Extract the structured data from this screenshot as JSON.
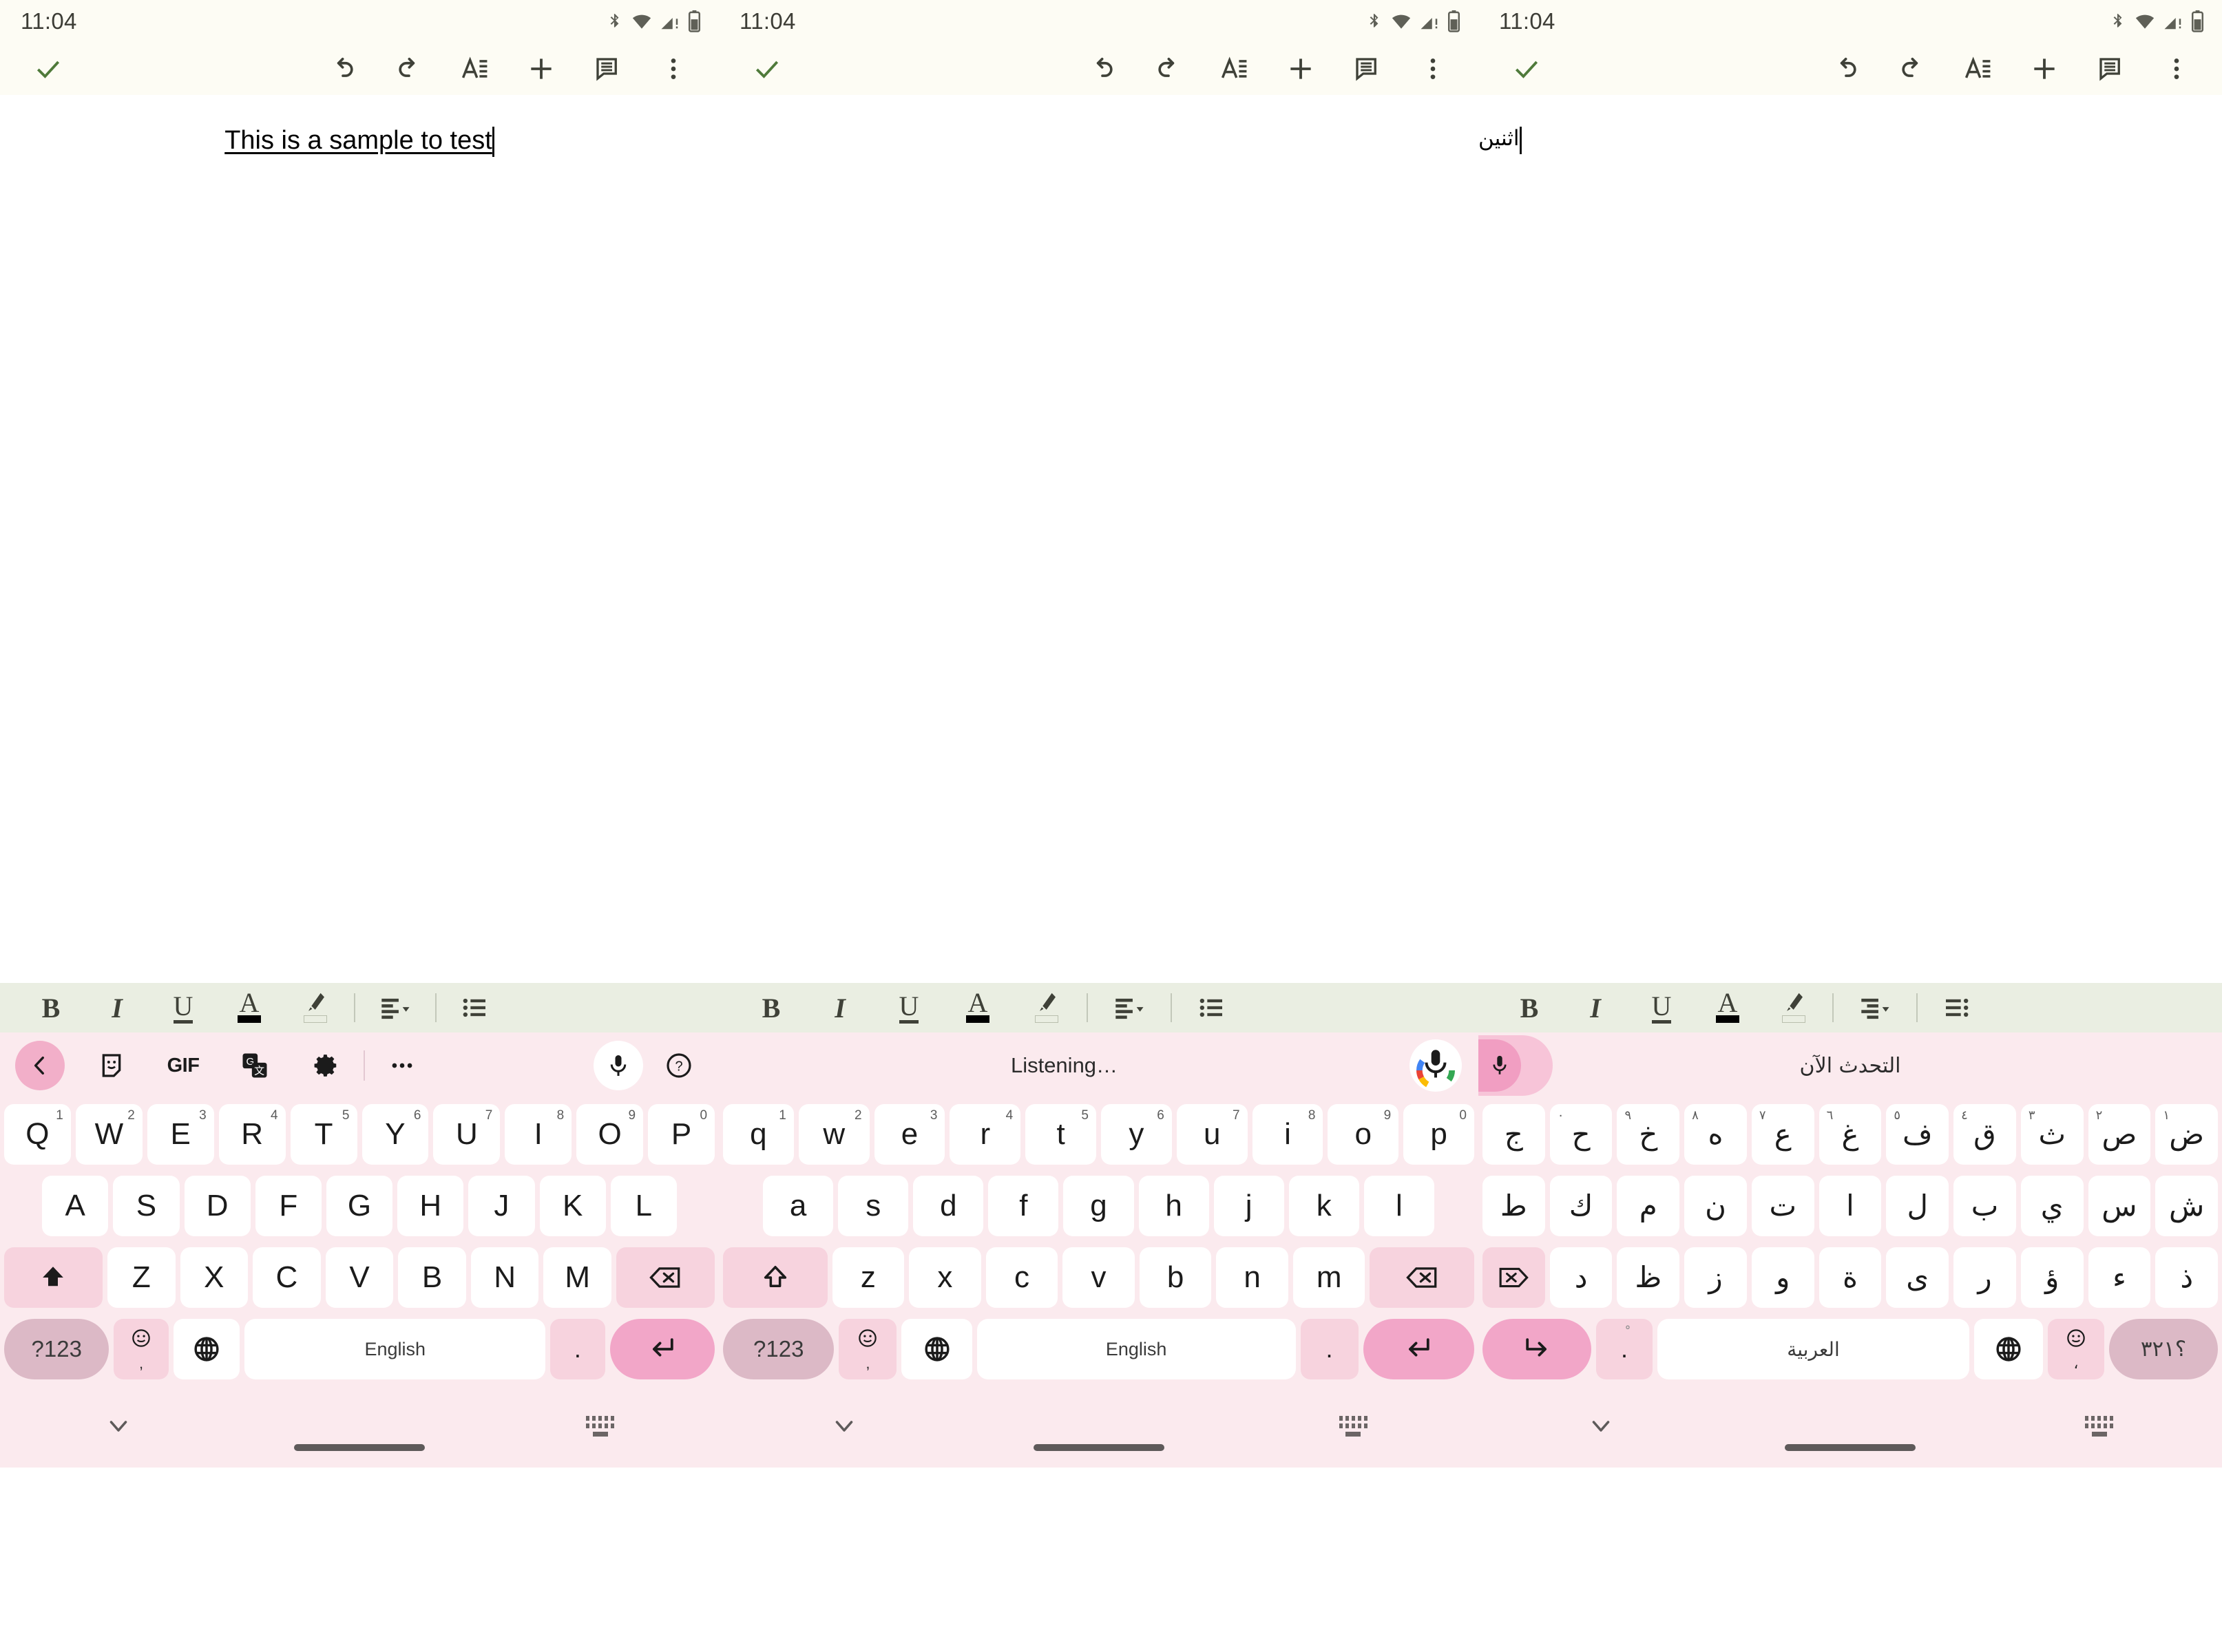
{
  "status": {
    "time": "11:04",
    "icons": [
      "bluetooth-icon",
      "wifi-icon",
      "cellular-alert-icon",
      "battery-icon"
    ]
  },
  "app_toolbar": {
    "accept_label": "check-icon",
    "actions": [
      {
        "name": "undo-button",
        "icon": "undo-icon"
      },
      {
        "name": "redo-button",
        "icon": "redo-icon"
      },
      {
        "name": "format-button",
        "icon": "text-format-icon"
      },
      {
        "name": "insert-button",
        "icon": "plus-icon"
      },
      {
        "name": "comment-button",
        "icon": "comment-icon"
      },
      {
        "name": "overflow-menu-button",
        "icon": "more-vert-icon"
      }
    ]
  },
  "documents": {
    "english_text": "This is a sample to test",
    "arabic_text": "اثنين"
  },
  "format_toolbar": {
    "bold": "B",
    "italic": "I",
    "underline": "U",
    "text_color": "A",
    "text_color_swatch": "#000000",
    "highlight": "highlighter-icon",
    "highlight_swatch": "none",
    "align": "align-left-icon",
    "align_rtl": "align-right-icon",
    "list": "bulleted-list-icon"
  },
  "keyboard_toolbar": {
    "back": "chevron-left-icon",
    "sticker": "sticker-icon",
    "gif": "GIF",
    "translate": "translate-icon",
    "settings": "gear-icon",
    "more": "more-horiz-icon",
    "mic": "mic-icon",
    "help": "help-icon"
  },
  "voice": {
    "english_status": "Listening…",
    "arabic_status": "التحدث الآن",
    "mic_icon": "google-mic-icon",
    "mic_colors": [
      "#4285f4",
      "#ea4335",
      "#fbbc05",
      "#34a853"
    ]
  },
  "keyboard_en_upper": {
    "row1": [
      {
        "k": "Q",
        "n": "1"
      },
      {
        "k": "W",
        "n": "2"
      },
      {
        "k": "E",
        "n": "3"
      },
      {
        "k": "R",
        "n": "4"
      },
      {
        "k": "T",
        "n": "5"
      },
      {
        "k": "Y",
        "n": "6"
      },
      {
        "k": "U",
        "n": "7"
      },
      {
        "k": "I",
        "n": "8"
      },
      {
        "k": "O",
        "n": "9"
      },
      {
        "k": "P",
        "n": "0"
      }
    ],
    "row2": [
      "A",
      "S",
      "D",
      "F",
      "G",
      "H",
      "J",
      "K",
      "L"
    ],
    "row3": [
      "Z",
      "X",
      "C",
      "V",
      "B",
      "N",
      "M"
    ],
    "shift": "shift-filled-icon",
    "backspace": "backspace-icon",
    "symbols": "?123",
    "emoji": "emoji-icon",
    "comma": ",",
    "globe": "globe-icon",
    "space_label": "English",
    "period": ".",
    "enter": "enter-icon"
  },
  "keyboard_en_lower": {
    "row1": [
      {
        "k": "q",
        "n": "1"
      },
      {
        "k": "w",
        "n": "2"
      },
      {
        "k": "e",
        "n": "3"
      },
      {
        "k": "r",
        "n": "4"
      },
      {
        "k": "t",
        "n": "5"
      },
      {
        "k": "y",
        "n": "6"
      },
      {
        "k": "u",
        "n": "7"
      },
      {
        "k": "i",
        "n": "8"
      },
      {
        "k": "o",
        "n": "9"
      },
      {
        "k": "p",
        "n": "0"
      }
    ],
    "row2": [
      "a",
      "s",
      "d",
      "f",
      "g",
      "h",
      "j",
      "k",
      "l"
    ],
    "row3": [
      "z",
      "x",
      "c",
      "v",
      "b",
      "n",
      "m"
    ],
    "shift": "shift-outline-icon",
    "backspace": "backspace-icon",
    "symbols": "?123",
    "emoji": "emoji-icon",
    "comma": ",",
    "globe": "globe-icon",
    "space_label": "English",
    "period": ".",
    "enter": "enter-icon"
  },
  "keyboard_ar": {
    "row1": [
      {
        "k": "ض",
        "n": "١"
      },
      {
        "k": "ص",
        "n": "٢"
      },
      {
        "k": "ث",
        "n": "٣"
      },
      {
        "k": "ق",
        "n": "٤"
      },
      {
        "k": "ف",
        "n": "٥"
      },
      {
        "k": "غ",
        "n": "٦"
      },
      {
        "k": "ع",
        "n": "٧"
      },
      {
        "k": "ه",
        "n": "٨"
      },
      {
        "k": "خ",
        "n": "٩"
      },
      {
        "k": "ح",
        "n": "٠"
      },
      {
        "k": "ج",
        "n": ""
      }
    ],
    "row2": [
      "ش",
      "س",
      "ي",
      "ب",
      "ل",
      "ا",
      "ت",
      "ن",
      "م",
      "ك",
      "ط"
    ],
    "row3": [
      "ذ",
      "ء",
      "ؤ",
      "ر",
      "ى",
      "ة",
      "و",
      "ز",
      "ظ",
      "د"
    ],
    "backspace": "backspace-icon",
    "symbols": "؟٣٢١",
    "emoji": "emoji-icon",
    "comma": "،",
    "globe": "globe-icon",
    "space_label": "العربية",
    "period": ".",
    "period_top": "ْ",
    "enter": "enter-icon"
  },
  "navbar": {
    "hide_keyboard": "chevron-down-icon",
    "home_pill": "home-indicator",
    "switch_keyboard": "keyboard-icon"
  }
}
